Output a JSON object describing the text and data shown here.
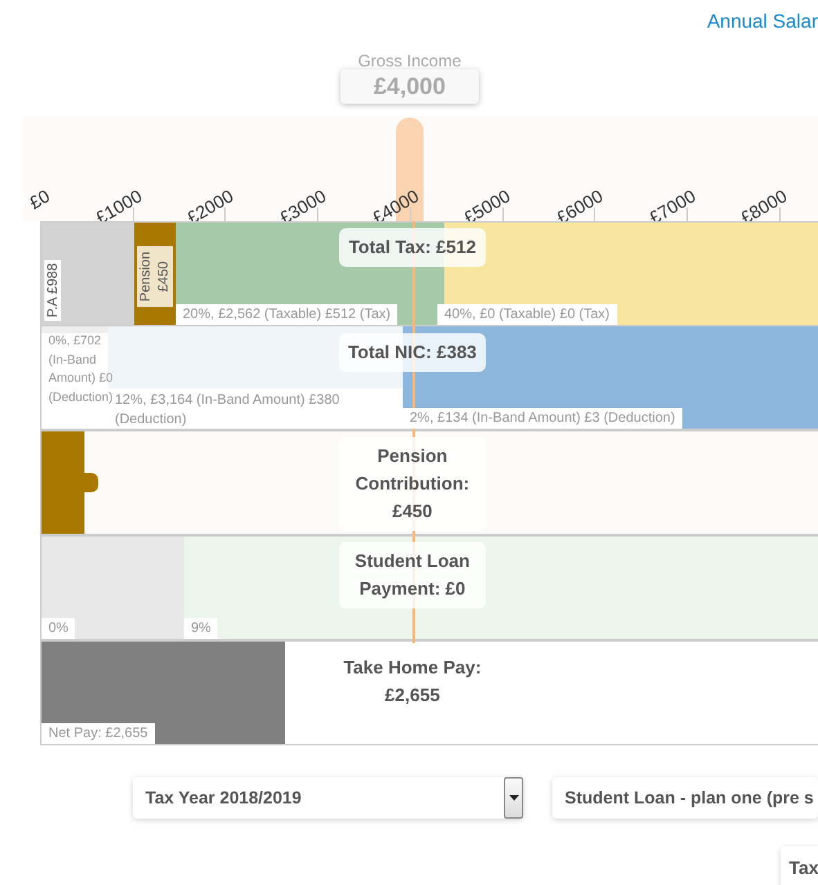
{
  "header_link": "Annual Salar",
  "gross_income": {
    "label": "Gross Income",
    "value": "£4,000",
    "level": 0.475
  },
  "axis": {
    "ticks": [
      "£0",
      "£1000",
      "£2000",
      "£3000",
      "£4000",
      "£5000",
      "£6000",
      "£7000",
      "£8000"
    ]
  },
  "rows": [
    {
      "kind": "tax",
      "tooltip": "Total Tax: £512",
      "bands": [
        {
          "kind": "allowance",
          "color": "#d3d3d3",
          "label": "P.A £988"
        },
        {
          "kind": "pension",
          "color": "#a87800",
          "label": "Pension £450"
        },
        {
          "kind": "basic",
          "color": "#a6c9a9",
          "label": "20%, £2,562 (Taxable) £512 (Tax)"
        },
        {
          "kind": "higher",
          "color": "#f8e6a0",
          "label": "40%, £0 (Taxable) £0 (Tax)"
        }
      ]
    },
    {
      "kind": "nic",
      "tooltip": "Total NIC: £383",
      "bands": [
        {
          "kind": "zero",
          "color": "#eeeeee",
          "label": "0%, £702 (In-Band Amount) £0 (Deduction)"
        },
        {
          "kind": "main",
          "color": "#eff5f9",
          "label": "12%, £3,164 (In-Band Amount) £380 (Deduction)"
        },
        {
          "kind": "upper",
          "color": "#8cb6dc",
          "label": "2%, £134 (In-Band Amount) £3 (Deduction)"
        }
      ]
    },
    {
      "kind": "pension",
      "tooltip": "Pension Contribution: £450",
      "bands": [
        {
          "kind": "contribution",
          "color": "#a87800"
        }
      ]
    },
    {
      "kind": "student",
      "tooltip": "Student Loan Payment: £0",
      "bands": [
        {
          "kind": "below",
          "color": "#e8e8e8",
          "label": "0%"
        },
        {
          "kind": "repay",
          "color": "#ecf6ec",
          "label": "9%"
        }
      ]
    },
    {
      "kind": "net",
      "tooltip": "Take Home Pay: £2,655",
      "bands": [
        {
          "kind": "net",
          "color": "#808080",
          "label": "Net Pay: £2,655"
        }
      ]
    }
  ],
  "selects": [
    {
      "value": "Tax Year 2018/2019",
      "toggle": true
    },
    {
      "value": "Student Loan - plan one (pre s",
      "toggle": false
    }
  ],
  "buttons": [
    "Tax"
  ]
}
